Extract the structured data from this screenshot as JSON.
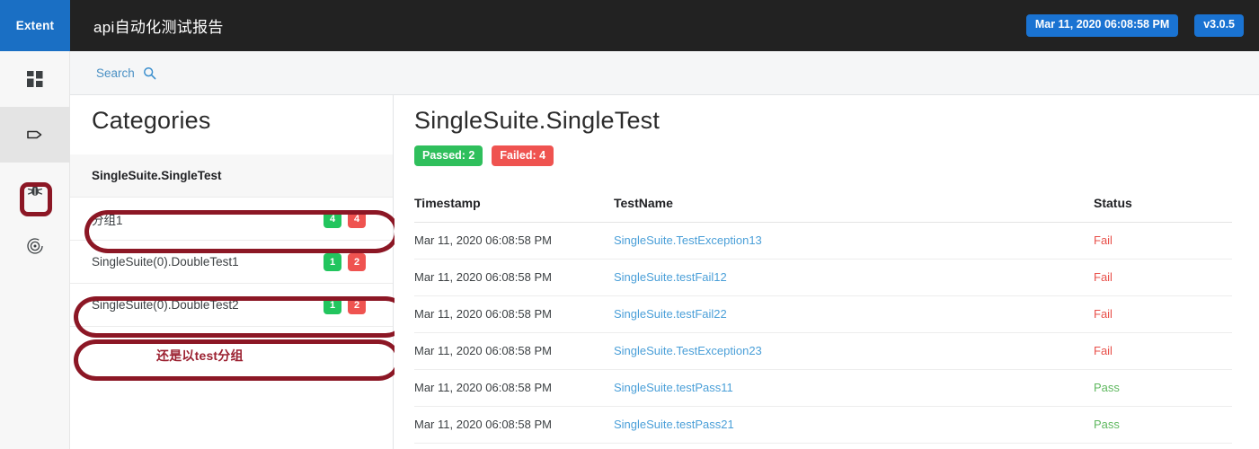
{
  "topbar": {
    "brand": "Extent",
    "report_title": "api自动化测试报告",
    "timestamp_pill": "Mar 11, 2020 06:08:58 PM",
    "version_pill": "v3.0.5",
    "brand_bg": "#1a6fc4",
    "bar_bg": "#222222",
    "pill_bg": "#1a73d2"
  },
  "rail": {
    "items": [
      {
        "icon": "dashboard-grid-icon",
        "active": false
      },
      {
        "icon": "tag-icon",
        "active": true
      },
      {
        "icon": "bug-icon",
        "active": false
      },
      {
        "icon": "target-icon",
        "active": false
      }
    ]
  },
  "search": {
    "label": "Search",
    "icon": "search-icon",
    "link_color": "#4a90c4"
  },
  "categories": {
    "title": "Categories",
    "note": "还是以test分组",
    "note_color": "#9b2030",
    "items": [
      {
        "label": "SingleSuite.SingleTest",
        "pass": "",
        "fail": "",
        "selected": true,
        "annotated": true
      },
      {
        "label": "分组1",
        "pass": "4",
        "fail": "4",
        "selected": false,
        "annotated": false
      },
      {
        "label": "SingleSuite(0).DoubleTest1",
        "pass": "1",
        "fail": "2",
        "selected": false,
        "annotated": true
      },
      {
        "label": "SingleSuite(0).DoubleTest2",
        "pass": "1",
        "fail": "2",
        "selected": false,
        "annotated": true
      }
    ]
  },
  "main": {
    "title": "SingleSuite.SingleTest",
    "passed_badge": "Passed: 2",
    "failed_badge": "Failed: 4",
    "pass_color": "#2fbf5c",
    "fail_color": "#ef5350",
    "table": {
      "columns": [
        "Timestamp",
        "TestName",
        "Status"
      ],
      "rows": [
        {
          "timestamp": "Mar 11, 2020 06:08:58 PM",
          "testname": "SingleSuite.TestException13",
          "status": "Fail"
        },
        {
          "timestamp": "Mar 11, 2020 06:08:58 PM",
          "testname": "SingleSuite.testFail12",
          "status": "Fail"
        },
        {
          "timestamp": "Mar 11, 2020 06:08:58 PM",
          "testname": "SingleSuite.testFail22",
          "status": "Fail"
        },
        {
          "timestamp": "Mar 11, 2020 06:08:58 PM",
          "testname": "SingleSuite.TestException23",
          "status": "Fail"
        },
        {
          "timestamp": "Mar 11, 2020 06:08:58 PM",
          "testname": "SingleSuite.testPass11",
          "status": "Pass"
        },
        {
          "timestamp": "Mar 11, 2020 06:08:58 PM",
          "testname": "SingleSuite.testPass21",
          "status": "Pass"
        }
      ]
    }
  },
  "annotation": {
    "color": "#8c1725"
  }
}
